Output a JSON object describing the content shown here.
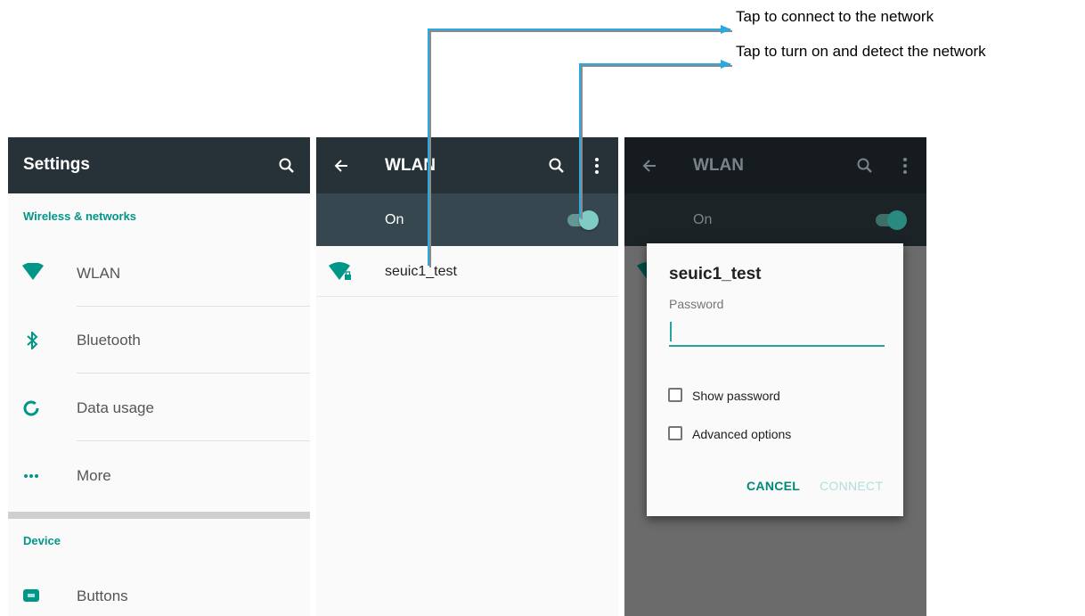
{
  "callouts": {
    "connect": "Tap to connect to the network",
    "turn_on": "Tap to turn on and detect the network"
  },
  "settings_panel": {
    "title": "Settings",
    "section_wireless": "Wireless & networks",
    "items": [
      {
        "label": "WLAN",
        "icon": "wifi-icon"
      },
      {
        "label": "Bluetooth",
        "icon": "bluetooth-icon"
      },
      {
        "label": "Data usage",
        "icon": "data-usage-icon"
      },
      {
        "label": "More",
        "icon": "more-dots-icon"
      }
    ],
    "section_device": "Device",
    "device_items": [
      {
        "label": "Buttons",
        "icon": "fn-buttons-icon"
      }
    ]
  },
  "wlan_panel": {
    "title": "WLAN",
    "toggle_label": "On",
    "toggle_state": "on",
    "network": "seuic1_test"
  },
  "dialog_panel": {
    "bg_title": "WLAN",
    "bg_toggle_label": "On",
    "dialog_title": "seuic1_test",
    "password_label": "Password",
    "password_value": "",
    "show_password": "Show password",
    "advanced_options": "Advanced options",
    "cancel": "CANCEL",
    "connect": "CONNECT"
  },
  "colors": {
    "toolbar": "#263238",
    "accent": "#009688",
    "teal_light": "#80cbc4",
    "arrow": "#29a9e0"
  }
}
